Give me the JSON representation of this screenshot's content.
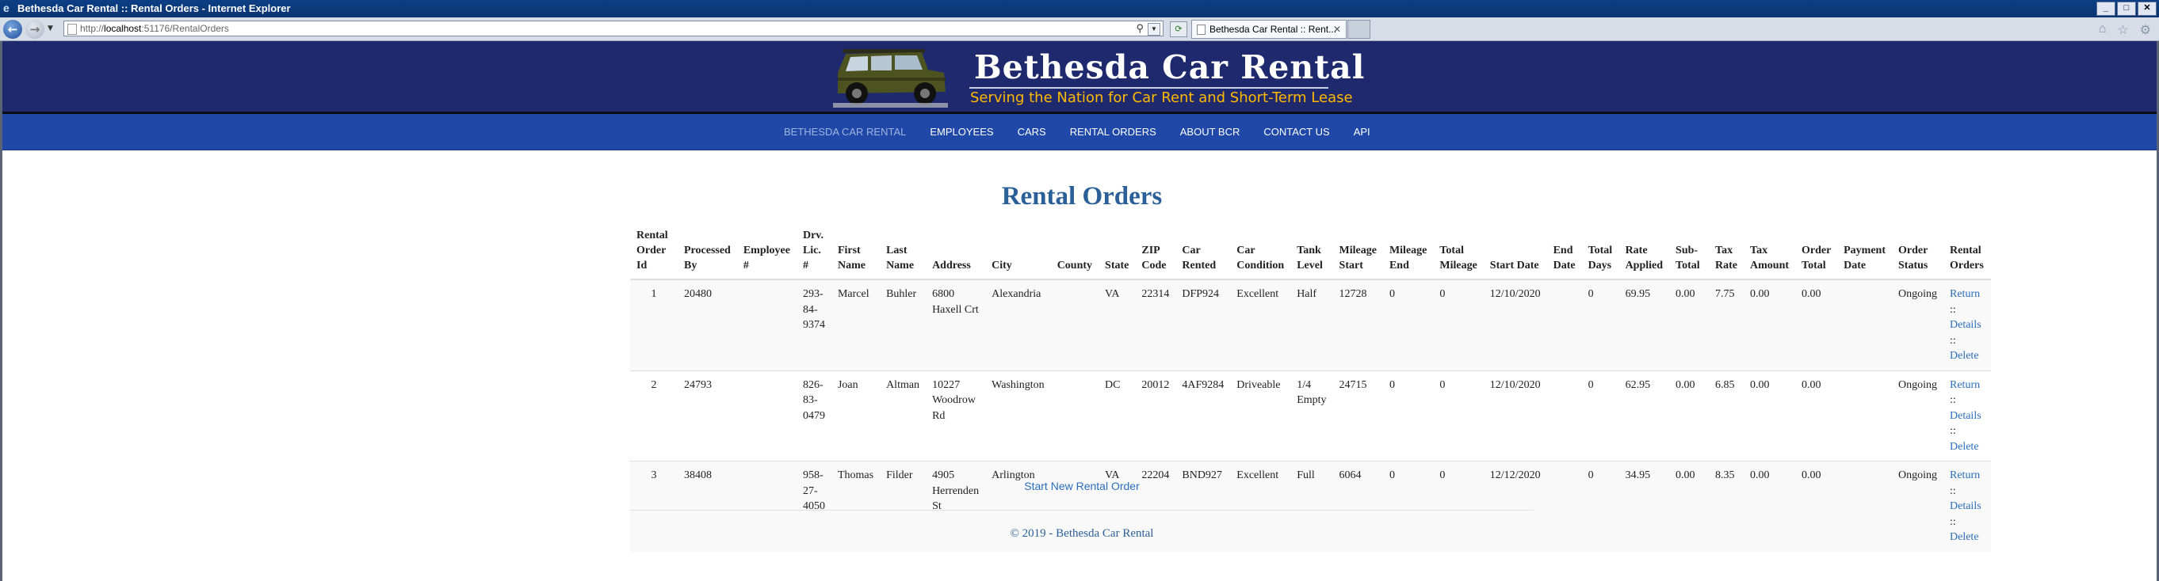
{
  "window": {
    "title": "Bethesda Car Rental :: Rental Orders - Internet Explorer"
  },
  "browser": {
    "url_prefix": "http://",
    "url_host": "localhost",
    "url_rest": ":51176/RentalOrders",
    "tab_label": "Bethesda Car Rental :: Rent...",
    "icons": [
      "back-icon",
      "forward-icon",
      "search-icon",
      "refresh-icon",
      "home-icon",
      "favorites-icon",
      "settings-icon"
    ]
  },
  "header": {
    "brand": "Bethesda Car Rental",
    "tagline": "Serving the Nation for Car Rent and Short-Term Lease"
  },
  "nav": {
    "items": [
      "BETHESDA CAR RENTAL",
      "EMPLOYEES",
      "CARS",
      "RENTAL ORDERS",
      "ABOUT BCR",
      "CONTACT US",
      "API"
    ]
  },
  "main": {
    "title": "Rental Orders",
    "columns": [
      "Rental Order Id",
      "Processed By",
      "Employee #",
      "Drv. Lic. #",
      "First Name",
      "Last Name",
      "Address",
      "City",
      "County",
      "State",
      "ZIP Code",
      "Car Rented",
      "Car Condition",
      "Tank Level",
      "Mileage Start",
      "Mileage End",
      "Total Mileage",
      "Start Date",
      "End Date",
      "Total Days",
      "Rate Applied",
      "Sub-Total",
      "Tax Rate",
      "Tax Amount",
      "Order Total",
      "Payment Date",
      "Order Status",
      "Rental Orders"
    ],
    "rows": [
      [
        "1",
        "20480",
        "",
        "293-84-9374",
        "Marcel",
        "Buhler",
        "6800 Haxell Crt",
        "Alexandria",
        "",
        "VA",
        "22314",
        "DFP924",
        "Excellent",
        "Half",
        "12728",
        "0",
        "0",
        "12/10/2020",
        "",
        "0",
        "69.95",
        "0.00",
        "7.75",
        "0.00",
        "0.00",
        "",
        "Ongoing"
      ],
      [
        "2",
        "24793",
        "",
        "826-83-0479",
        "Joan",
        "Altman",
        "10227 Woodrow Rd",
        "Washington",
        "",
        "DC",
        "20012",
        "4AF9284",
        "Driveable",
        "1/4 Empty",
        "24715",
        "0",
        "0",
        "12/10/2020",
        "",
        "0",
        "62.95",
        "0.00",
        "6.85",
        "0.00",
        "0.00",
        "",
        "Ongoing"
      ],
      [
        "3",
        "38408",
        "",
        "958-27-4050",
        "Thomas",
        "Filder",
        "4905 Herrenden St",
        "Arlington",
        "",
        "VA",
        "22204",
        "BND927",
        "Excellent",
        "Full",
        "6064",
        "0",
        "0",
        "12/12/2020",
        "",
        "0",
        "34.95",
        "0.00",
        "8.35",
        "0.00",
        "0.00",
        "",
        "Ongoing"
      ]
    ],
    "actions": {
      "return": "Return",
      "details": "Details",
      "delete": "Delete",
      "separator": " ::"
    },
    "start_new": "Start New Rental Order"
  },
  "footer": {
    "text": "© 2019 - Bethesda Car Rental"
  }
}
